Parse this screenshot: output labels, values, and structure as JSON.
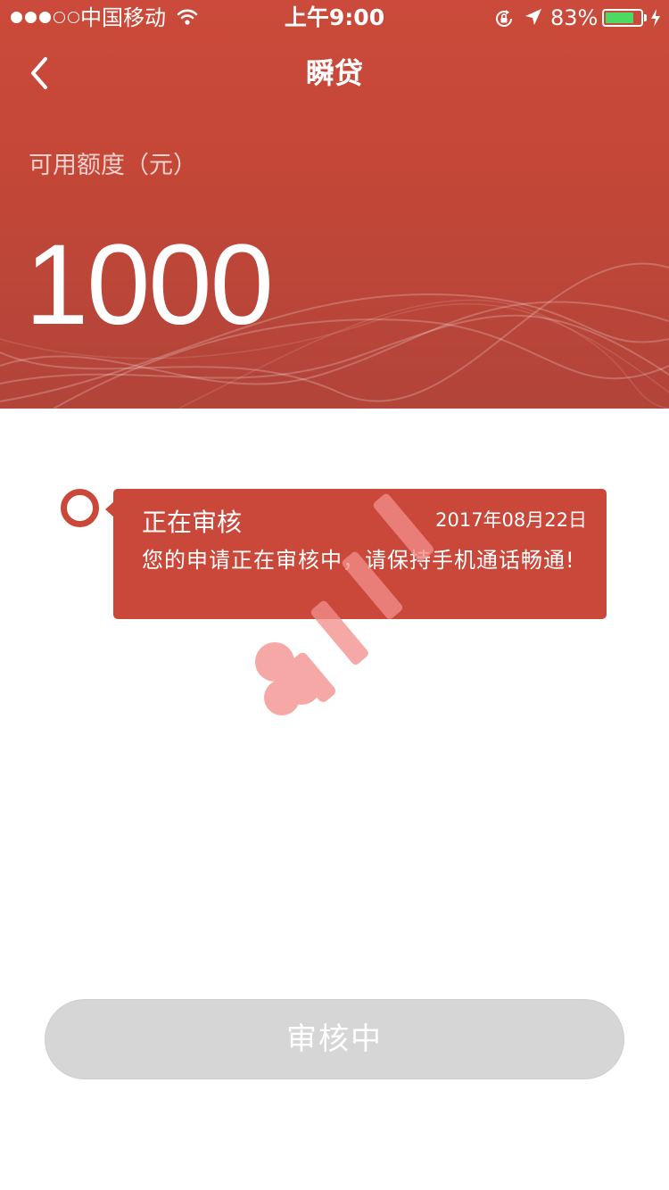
{
  "status_bar": {
    "signal_strength": 3,
    "signal_max": 5,
    "carrier": "中国移动",
    "time": "上午9:00",
    "battery_percent": "83%",
    "battery_level": 0.83,
    "battery_color": "#4cd964"
  },
  "nav": {
    "back_icon": "chevron-left-icon",
    "title": "瞬贷"
  },
  "credit": {
    "label": "可用额度（元）",
    "amount": "1000"
  },
  "timeline": {
    "items": [
      {
        "title": "正在审核",
        "date": "2017年08月22日",
        "message": "您的申请正在审核中，请保持手机通话畅通!"
      }
    ]
  },
  "action": {
    "button_label": "审核中"
  },
  "colors": {
    "brand_red": "#c9483a",
    "button_disabled": "#d6d6d6"
  }
}
